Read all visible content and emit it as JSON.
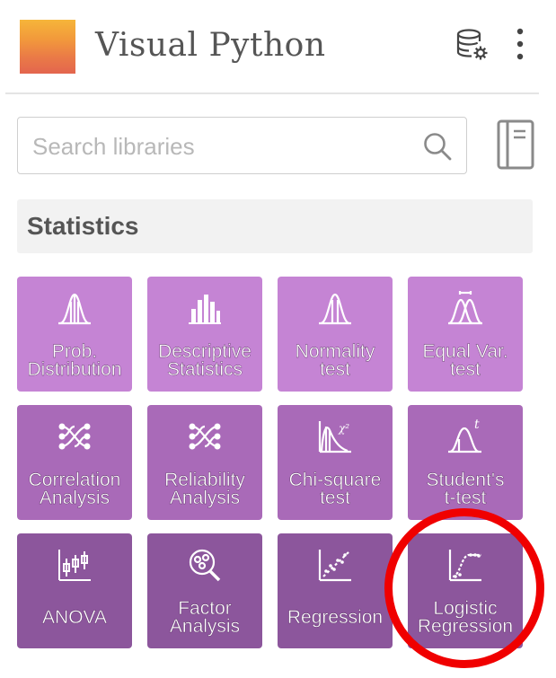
{
  "app": {
    "title": "Visual Python"
  },
  "header": {
    "icons": [
      "database-settings-icon",
      "more-vertical-icon"
    ]
  },
  "search": {
    "placeholder": "Search libraries",
    "value": ""
  },
  "section": {
    "title": "Statistics"
  },
  "tiles": [
    {
      "label": "Prob.\nDistribution",
      "icon": "bell-curve-icon"
    },
    {
      "label": "Descriptive\nStatistics",
      "icon": "histogram-icon"
    },
    {
      "label": "Normality\ntest",
      "icon": "normal-curve-icon"
    },
    {
      "label": "Equal Var.\ntest",
      "icon": "overlapping-curves-icon"
    },
    {
      "label": "Correlation\nAnalysis",
      "icon": "network-icon"
    },
    {
      "label": "Reliability\nAnalysis",
      "icon": "network-icon"
    },
    {
      "label": "Chi-square\ntest",
      "icon": "chi-square-icon"
    },
    {
      "label": "Student's\nt-test",
      "icon": "t-distribution-icon"
    },
    {
      "label": "ANOVA",
      "icon": "boxplot-icon"
    },
    {
      "label": "Factor\nAnalysis",
      "icon": "magnifier-cluster-icon"
    },
    {
      "label": "Regression",
      "icon": "scatter-trend-icon"
    },
    {
      "label": "Logistic\nRegression",
      "icon": "logistic-curve-icon"
    }
  ],
  "colors": {
    "tile_row1": "#c584d4",
    "tile_row2": "#a96ab8",
    "tile_row3": "#8c569c",
    "highlight": "#f00000"
  }
}
